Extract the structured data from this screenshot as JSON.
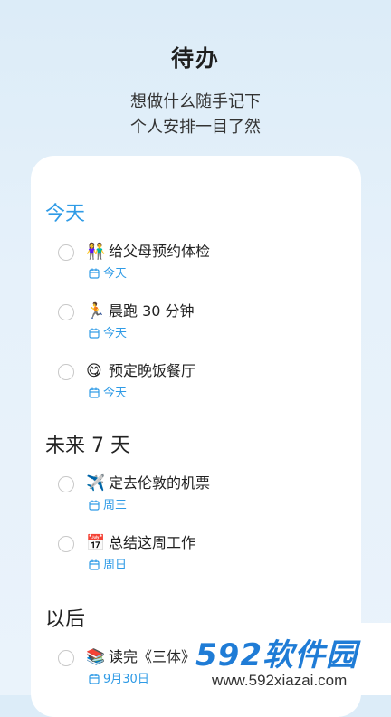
{
  "hero": {
    "title": "待办",
    "subtitle_line1": "想做什么随手记下",
    "subtitle_line2": "个人安排一目了然"
  },
  "sections": [
    {
      "title": "今天",
      "items": [
        {
          "emoji": "👫",
          "text": "给父母预约体检",
          "date": "今天"
        },
        {
          "emoji": "🏃",
          "text": "晨跑 30 分钟",
          "date": "今天"
        },
        {
          "emoji": "😋",
          "text": "预定晚饭餐厅",
          "date": "今天"
        }
      ]
    },
    {
      "title": "未来 7 天",
      "items": [
        {
          "emoji": "✈️",
          "text": "定去伦敦的机票",
          "date": "周三"
        },
        {
          "emoji": "📅",
          "text": "总结这周工作",
          "date": "周日"
        }
      ]
    },
    {
      "title": "以后",
      "items": [
        {
          "emoji": "📚",
          "text": "读完《三体》",
          "date": "9月30日"
        }
      ]
    }
  ],
  "watermark": {
    "logo_text": "592软件园",
    "url": "www.592xiazai.com"
  },
  "colors": {
    "accent": "#2f9be6",
    "background": "#e2eff9",
    "card": "#ffffff",
    "watermark": "#1f7cd6"
  }
}
